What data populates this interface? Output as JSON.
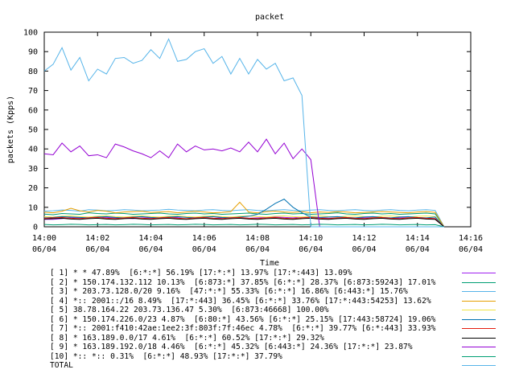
{
  "chart_data": {
    "type": "line",
    "title": "packet",
    "xlabel": "Time",
    "ylabel": "packets (Kpps)",
    "ylim": [
      0,
      100
    ],
    "yticks": [
      0,
      10,
      20,
      30,
      40,
      50,
      60,
      70,
      80,
      90,
      100
    ],
    "xlim": [
      "14:00",
      "14:16"
    ],
    "xticks": [
      {
        "time": "14:00",
        "date": "06/04"
      },
      {
        "time": "14:02",
        "date": "06/04"
      },
      {
        "time": "14:04",
        "date": "06/04"
      },
      {
        "time": "14:06",
        "date": "06/04"
      },
      {
        "time": "14:08",
        "date": "06/04"
      },
      {
        "time": "14:10",
        "date": "06/04"
      },
      {
        "time": "14:12",
        "date": "06/04"
      },
      {
        "time": "14:14",
        "date": "06/04"
      },
      {
        "time": "14:16",
        "date": "06/04"
      }
    ],
    "grid": false,
    "legend_position": "bottom",
    "x": [
      "14:00",
      "14:00:20",
      "14:00:40",
      "14:01",
      "14:01:20",
      "14:01:40",
      "14:02",
      "14:02:20",
      "14:02:40",
      "14:03",
      "14:03:20",
      "14:03:40",
      "14:04",
      "14:04:20",
      "14:04:40",
      "14:05",
      "14:05:20",
      "14:05:40",
      "14:06",
      "14:06:20",
      "14:06:40",
      "14:07",
      "14:07:20",
      "14:07:40",
      "14:08",
      "14:08:20",
      "14:08:40",
      "14:09",
      "14:09:20",
      "14:09:40",
      "14:10",
      "14:10:20",
      "14:10:40",
      "14:11",
      "14:11:20",
      "14:11:40",
      "14:12",
      "14:12:20",
      "14:12:40",
      "14:13",
      "14:13:20",
      "14:13:40",
      "14:14",
      "14:14:20",
      "14:14:40",
      "14:15"
    ],
    "series": [
      {
        "label": "[ 1] * * 47.89%  [6:*:*] 56.19% [17:*:*] 13.97% [17:*:443] 13.09%",
        "color": "#a020f0",
        "values": [
          3.8,
          3.8,
          4.2,
          4.8,
          4.6,
          4.6,
          5.2,
          4.8,
          4.6,
          4.4,
          4.2,
          4.6,
          4.6,
          4.4,
          4.6,
          4.8,
          5.0,
          4.6,
          4.8,
          4.4,
          4.6,
          5.0,
          4.6,
          4.4,
          4.6,
          4.8,
          5.0,
          4.8,
          4.6,
          5.0,
          4.8,
          4.6,
          4.4,
          4.6,
          4.6,
          4.4,
          4.6,
          4.8,
          4.6,
          4.4,
          4.6,
          4.8,
          4.6,
          4.4,
          4.2,
          0
        ]
      },
      {
        "label": "[ 2] * 150.174.132.112 10.13%  [6:873:*] 37.85% [6:*:*] 28.37% [6:873:59243] 17.01%",
        "color": "#009e73",
        "values": [
          6.5,
          6.2,
          6.8,
          6.6,
          6.4,
          7.2,
          6.8,
          6.6,
          7.0,
          6.8,
          6.4,
          6.6,
          6.8,
          7.0,
          6.6,
          6.4,
          6.8,
          7.0,
          6.6,
          6.8,
          6.4,
          6.6,
          6.8,
          7.0,
          6.6,
          6.4,
          6.8,
          7.0,
          6.6,
          6.8,
          6.4,
          6.6,
          6.8,
          7.2,
          6.6,
          6.4,
          6.8,
          7.0,
          6.6,
          6.8,
          6.4,
          6.6,
          6.8,
          7.0,
          6.6,
          0
        ]
      },
      {
        "label": "[ 3] * 203.73.128.0/20 9.16%  [47:*:*] 55.33% [6:*:*] 16.86% [6:443:*] 15.76%",
        "color": "#56b4e9",
        "values": [
          8.0,
          8.2,
          8.6,
          8.4,
          8.0,
          8.8,
          8.6,
          8.2,
          8.4,
          8.8,
          8.6,
          8.2,
          8.4,
          8.6,
          9.0,
          8.6,
          8.4,
          8.2,
          8.6,
          8.8,
          8.4,
          8.2,
          8.6,
          8.8,
          8.4,
          8.2,
          8.6,
          8.8,
          8.4,
          8.2,
          8.6,
          8.8,
          8.4,
          8.2,
          8.6,
          8.8,
          8.4,
          8.2,
          8.6,
          8.8,
          8.4,
          8.2,
          8.6,
          8.8,
          8.4,
          0
        ]
      },
      {
        "label": "[ 4] *:: 2001::/16 8.49%  [17:*:443] 36.45% [6:*:*] 33.76% [17:*:443:54253] 13.62%",
        "color": "#e69f00",
        "values": [
          7.5,
          7.2,
          8.0,
          9.5,
          8.2,
          7.6,
          8.4,
          8.0,
          7.2,
          7.6,
          7.8,
          8.0,
          7.4,
          7.6,
          7.8,
          7.2,
          7.6,
          8.0,
          7.6,
          7.2,
          7.4,
          7.8,
          12.6,
          7.6,
          7.2,
          7.8,
          8.0,
          7.6,
          7.4,
          7.8,
          7.2,
          7.6,
          7.4,
          7.8,
          7.6,
          7.2,
          7.4,
          7.6,
          7.8,
          7.6,
          7.4,
          7.2,
          7.6,
          7.8,
          7.4,
          0
        ]
      },
      {
        "label": "[ 5] 38.78.164.22 203.73.136.47 5.30%  [6:873:46668] 100.00%",
        "color": "#f0e442",
        "values": [
          5.2,
          5.0,
          5.4,
          5.6,
          5.2,
          5.0,
          5.4,
          5.6,
          5.2,
          5.0,
          5.4,
          5.6,
          5.2,
          5.0,
          5.4,
          5.6,
          5.2,
          5.0,
          5.4,
          5.6,
          5.2,
          5.0,
          5.4,
          5.6,
          5.2,
          5.0,
          5.4,
          5.6,
          5.2,
          5.0,
          5.4,
          5.6,
          5.2,
          5.0,
          5.4,
          5.6,
          5.2,
          5.0,
          5.4,
          5.6,
          5.2,
          5.0,
          5.4,
          5.6,
          5.2,
          0
        ]
      },
      {
        "label": "[ 6] * 150.174.226.0/23 4.87%  [6:80:*] 43.56% [6:*:*] 25.15% [17:443:58724] 19.06%",
        "color": "#0072b2",
        "values": [
          4.6,
          4.8,
          5.2,
          5.0,
          4.8,
          4.6,
          5.0,
          5.2,
          4.8,
          4.6,
          5.0,
          5.2,
          4.8,
          4.6,
          5.0,
          5.2,
          4.8,
          4.6,
          5.0,
          5.2,
          4.8,
          4.6,
          5.0,
          5.4,
          6.4,
          9.0,
          12.0,
          14.2,
          10.0,
          7.2,
          5.0,
          4.8,
          5.0,
          5.2,
          4.8,
          4.6,
          5.0,
          5.2,
          4.8,
          4.6,
          5.0,
          5.2,
          4.8,
          4.6,
          5.0,
          0
        ]
      },
      {
        "label": "[ 7] *:: 2001:f410:42ae:1ee2:3f:803f:7f:46ec 4.78%  [6:*:*] 39.77% [6:*:443] 33.93%",
        "color": "#e51e10",
        "values": [
          4.4,
          4.6,
          4.8,
          4.4,
          4.2,
          4.6,
          4.8,
          4.4,
          4.2,
          4.6,
          4.8,
          4.4,
          4.2,
          4.6,
          4.8,
          4.4,
          4.2,
          4.6,
          4.8,
          4.4,
          4.2,
          4.6,
          4.8,
          4.4,
          4.2,
          4.6,
          4.8,
          4.4,
          4.2,
          4.6,
          4.8,
          4.4,
          4.2,
          4.6,
          4.8,
          4.4,
          4.2,
          4.6,
          4.8,
          4.4,
          4.2,
          4.6,
          4.8,
          4.4,
          4.2,
          0
        ]
      },
      {
        "label": "[ 8] * 163.189.0.0/17 4.61%  [6:*:*] 60.52% [17:*:*] 29.32%",
        "color": "#000000",
        "values": [
          4.0,
          4.2,
          4.4,
          4.0,
          3.8,
          4.2,
          4.4,
          4.0,
          3.8,
          4.2,
          4.4,
          4.0,
          3.8,
          4.2,
          4.4,
          4.0,
          3.8,
          4.2,
          4.4,
          4.0,
          3.8,
          4.2,
          4.4,
          4.0,
          3.8,
          4.2,
          4.4,
          4.0,
          3.8,
          4.2,
          4.4,
          4.0,
          3.8,
          4.2,
          4.4,
          4.0,
          3.8,
          4.2,
          4.4,
          4.0,
          3.8,
          4.2,
          4.4,
          4.0,
          3.8,
          0
        ]
      },
      {
        "label": "[ 9] * 163.189.192.0/18 4.46%  [6:*:*] 45.32% [6:443:*] 24.36% [17:*:*] 23.87%",
        "color": "#9400d3",
        "values": [
          37.5,
          37.0,
          43.0,
          38.5,
          41.5,
          36.5,
          37.0,
          35.5,
          42.5,
          41.0,
          39.0,
          37.5,
          35.5,
          39.0,
          35.5,
          42.5,
          38.5,
          41.5,
          39.5,
          40.0,
          39.0,
          40.5,
          38.5,
          43.5,
          38.5,
          45.0,
          37.5,
          43.0,
          35.0,
          40.0,
          34.5,
          0,
          0,
          0,
          0,
          0,
          0,
          0,
          0,
          0,
          0,
          0,
          0,
          0,
          0,
          0
        ]
      },
      {
        "label": "[10] *:: *:: 0.31%  [6:*:*] 48.93% [17:*:*] 37.79%",
        "color": "#009e73",
        "values": [
          1.2,
          1.0,
          1.1,
          1.3,
          1.2,
          1.0,
          1.1,
          1.2,
          1.0,
          1.1,
          1.3,
          1.2,
          1.0,
          1.1,
          1.2,
          1.0,
          1.1,
          1.3,
          1.2,
          1.0,
          1.1,
          1.2,
          1.0,
          1.1,
          1.3,
          1.2,
          1.0,
          1.1,
          1.2,
          1.0,
          1.1,
          1.3,
          1.2,
          1.0,
          1.1,
          1.2,
          1.0,
          1.1,
          1.3,
          1.2,
          1.0,
          1.1,
          1.2,
          1.0,
          1.1,
          0
        ]
      },
      {
        "label": "TOTAL",
        "color": "#56b4e9",
        "values": [
          80.0,
          83.5,
          92.0,
          80.5,
          87.0,
          75.0,
          81.0,
          78.5,
          86.5,
          87.0,
          84.0,
          85.5,
          91.0,
          86.5,
          96.5,
          85.0,
          86.0,
          90.0,
          91.5,
          84.0,
          87.5,
          78.5,
          86.5,
          78.5,
          86.0,
          81.0,
          84.0,
          75.0,
          76.5,
          67.5,
          0,
          0,
          0,
          0,
          0,
          0,
          0,
          0,
          0,
          0,
          0,
          0,
          0,
          0,
          0,
          0
        ]
      }
    ]
  }
}
